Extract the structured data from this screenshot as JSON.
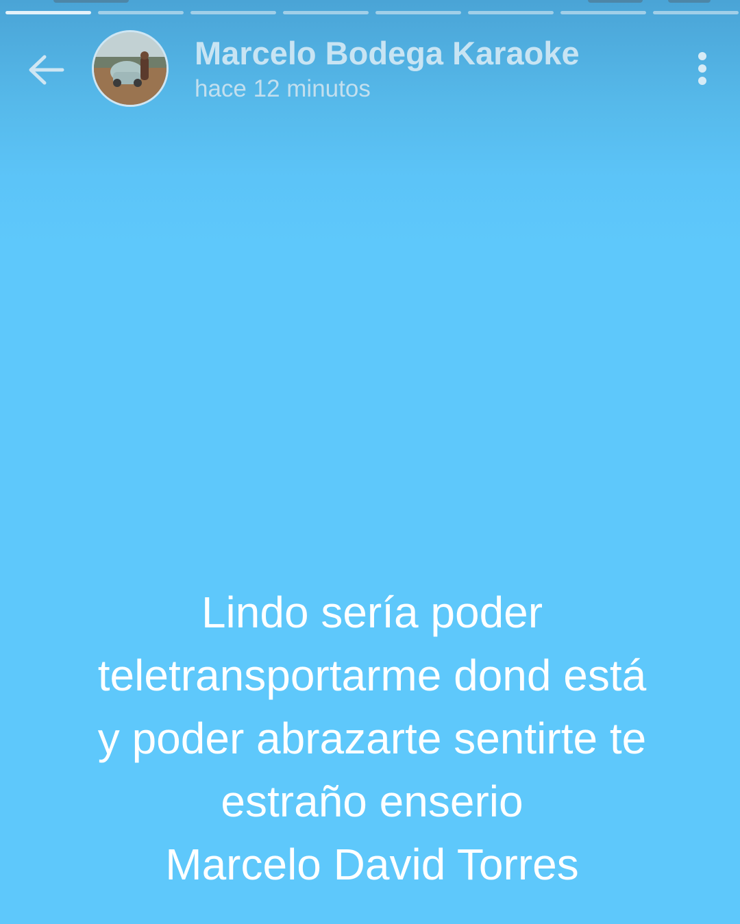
{
  "story": {
    "segments_total": 8,
    "active_segment": 1,
    "header": {
      "contact_name": "Marcelo Bodega Karaoke",
      "timestamp": "hace 12 minutos",
      "back_icon": "arrow-left-icon",
      "menu_icon": "more-vert-icon"
    },
    "message_lines": [
      "Lindo sería poder",
      "teletransportarme dond está",
      "y poder abrazarte sentirte te",
      "estraño enserio",
      "Marcelo David Torres"
    ],
    "background_color": "#5ec8fb"
  }
}
